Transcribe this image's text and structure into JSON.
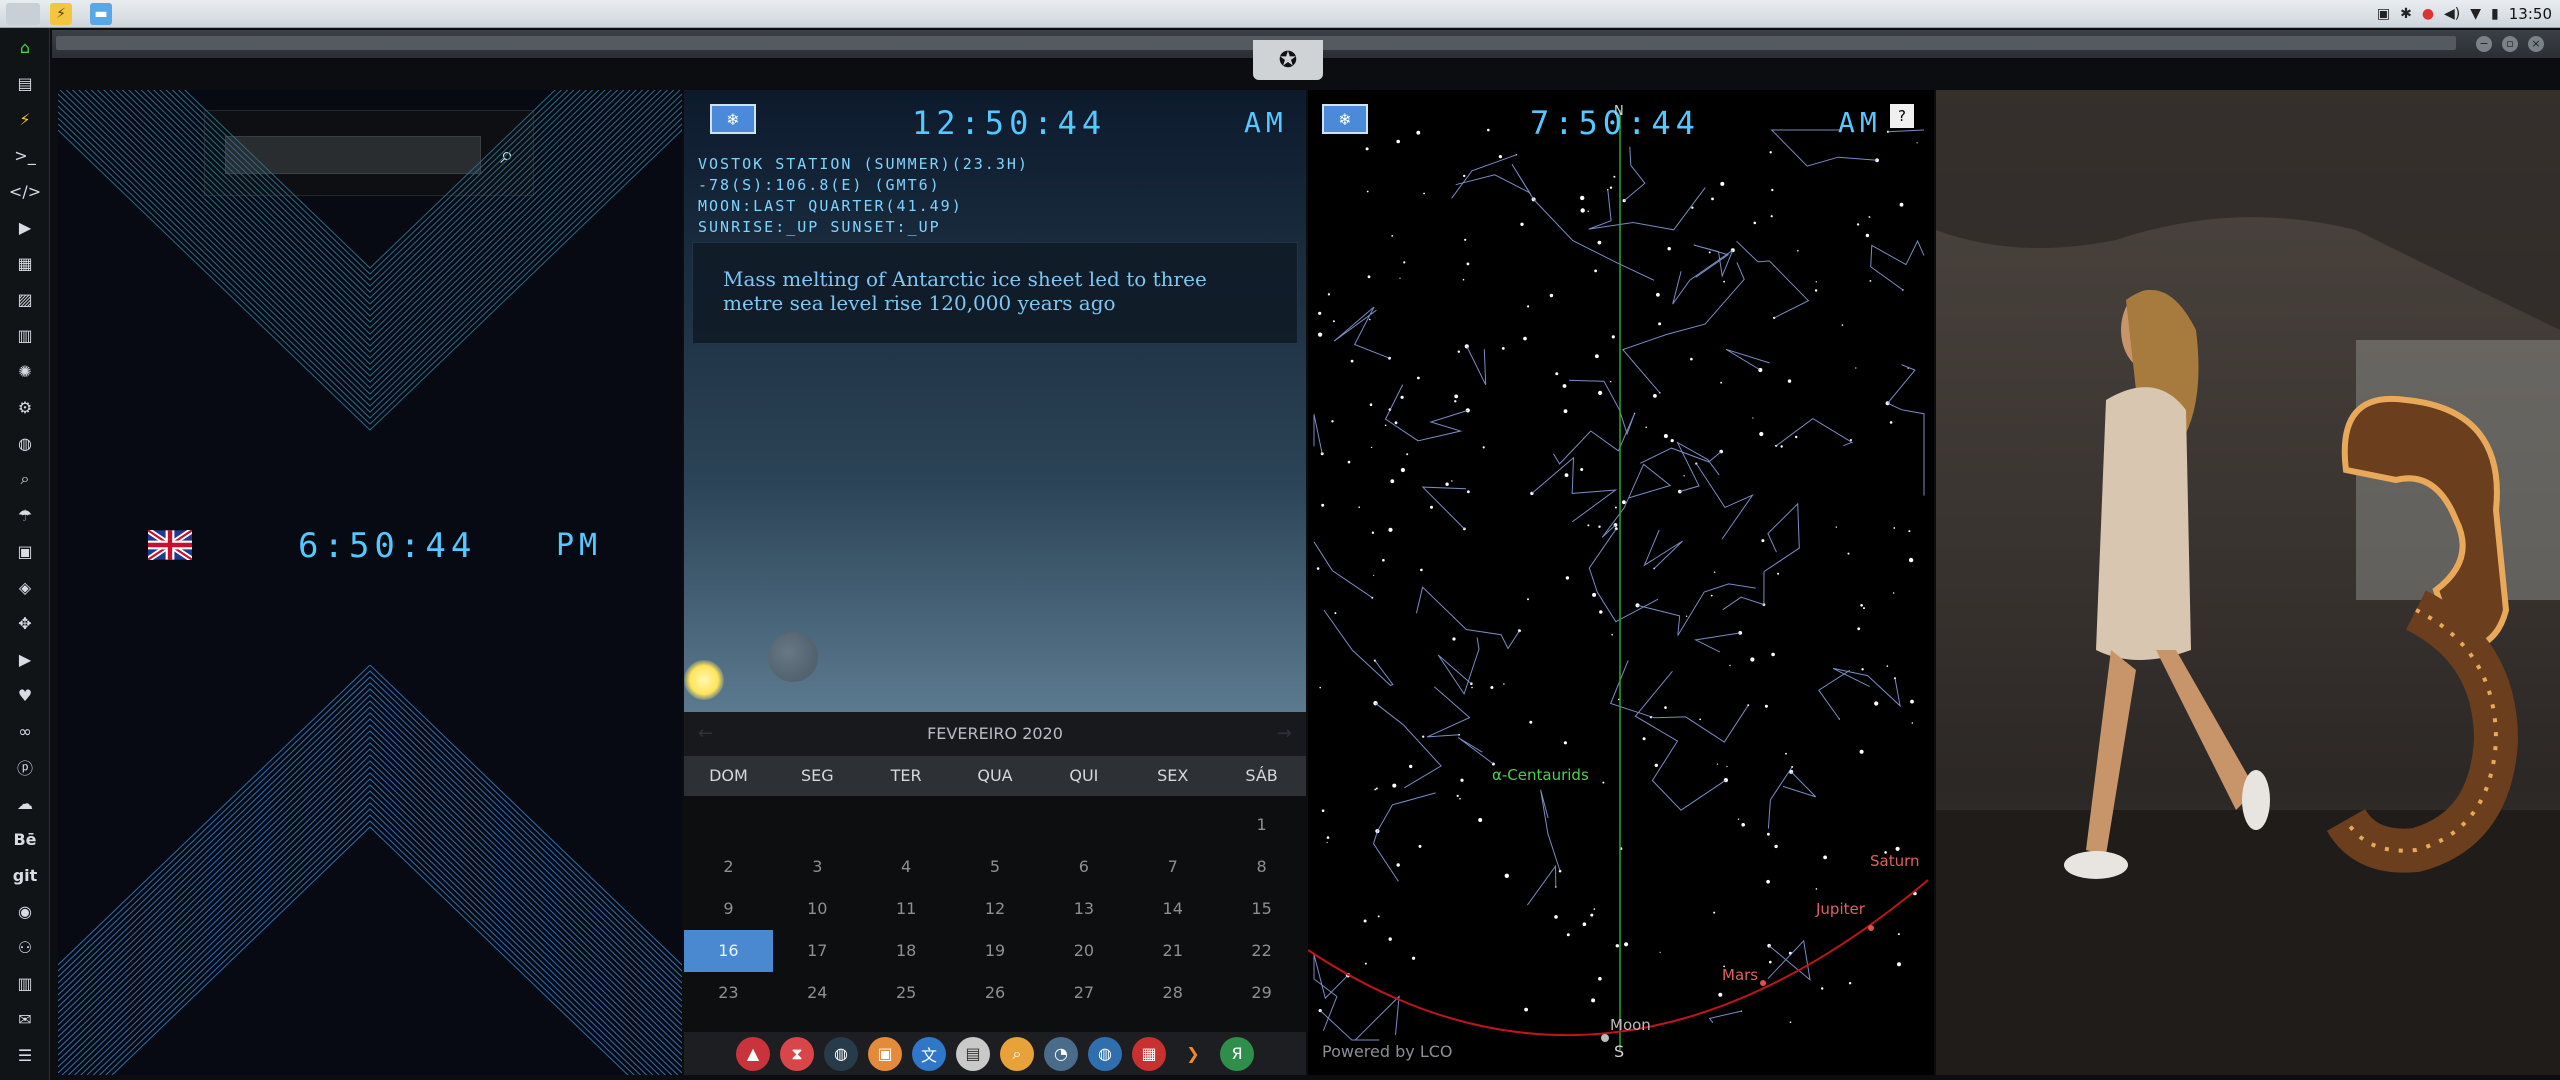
{
  "topbar": {
    "clock": "13:50",
    "tray_icons": [
      "image-icon",
      "bluetooth-icon",
      "record-icon",
      "volume-icon",
      "wifi-icon",
      "battery-icon"
    ]
  },
  "sidebar": {
    "items": [
      "home-icon",
      "document-icon",
      "lightning-icon",
      "terminal-icon",
      "code-icon",
      "play-icon",
      "contacts-icon",
      "image-icon",
      "news-icon",
      "aperture-icon",
      "gear-icon",
      "globe-icon",
      "search-icon",
      "umbrella-icon",
      "id-card-icon",
      "tag-icon",
      "expand-icon",
      "youtube-icon",
      "heart-icon",
      "infinity-icon",
      "pinterest-icon",
      "cloud-icon",
      "behance-icon",
      "git-icon",
      "github-icon",
      "people-icon",
      "map-icon",
      "mail-icon",
      "list-icon"
    ],
    "behance": "Bē",
    "git": "git"
  },
  "colors": {
    "digit": "#55c8ff",
    "today": "#4a88cf",
    "constellation": "#8fa6e6",
    "ecliptic": "#c0141c",
    "meridian": "#2fa82f"
  },
  "clock_uk": {
    "time": "6:50:44",
    "ampm": "PM"
  },
  "antarctica": {
    "time": "12:50:44",
    "ampm": "AM",
    "station_lines": [
      "VOSTOK STATION (SUMMER)(23.3H)",
      "-78(S):106.8(E) (GMT6)",
      "MOON:LAST QUARTER(41.49)",
      "SUNRISE:_UP SUNSET:_UP"
    ],
    "news": "Mass melting of Antarctic ice sheet led to three metre sea level rise 120,000 years ago"
  },
  "calendar": {
    "month": "FEVEREIRO 2020",
    "days_of_week": [
      "DOM",
      "SEG",
      "TER",
      "QUA",
      "QUI",
      "SEX",
      "SÁB"
    ],
    "weeks": [
      [
        "",
        "",
        "",
        "",
        "",
        "",
        "1"
      ],
      [
        "2",
        "3",
        "4",
        "5",
        "6",
        "7",
        "8"
      ],
      [
        "9",
        "10",
        "11",
        "12",
        "13",
        "14",
        "15"
      ],
      [
        "16",
        "17",
        "18",
        "19",
        "20",
        "21",
        "22"
      ],
      [
        "23",
        "24",
        "25",
        "26",
        "27",
        "28",
        "29"
      ]
    ],
    "today": "16"
  },
  "dock": [
    "arrow-icon",
    "hourglass-icon",
    "earth-icon",
    "photos-icon",
    "translate-icon",
    "news-icon",
    "search-icon",
    "clock-icon",
    "globe-icon",
    "calendar-icon",
    "sublime-icon",
    "yandex-icon"
  ],
  "sky": {
    "time": "7:50:44",
    "ampm": "AM",
    "help": "?",
    "north": "N",
    "south": "S",
    "labels": {
      "centaurids": "α-Centaurids",
      "saturn": "Saturn",
      "jupiter": "Jupiter",
      "mars": "Mars",
      "moon": "Moon"
    },
    "powered": "Powered by LCO"
  }
}
